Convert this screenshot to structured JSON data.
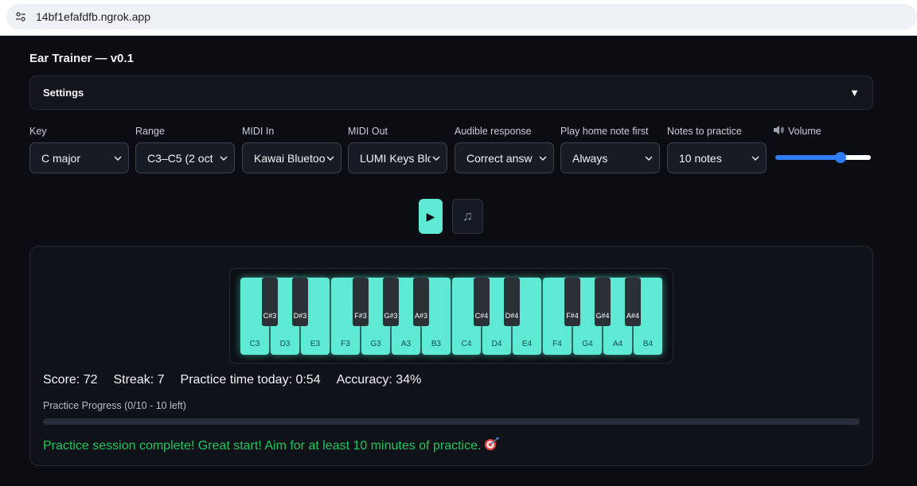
{
  "browser": {
    "url": "14bf1efafdfb.ngrok.app"
  },
  "app": {
    "title": "Ear Trainer — v0.1"
  },
  "settings": {
    "label": "Settings",
    "toggle": "▼"
  },
  "controls": [
    {
      "label": "Key",
      "value": "C major"
    },
    {
      "label": "Range",
      "value": "C3–C5 (2 oct"
    },
    {
      "label": "MIDI In",
      "value": "Kawai Bluetoo"
    },
    {
      "label": "MIDI Out",
      "value": "LUMI Keys Blo"
    },
    {
      "label": "Audible response",
      "value": "Correct answ"
    },
    {
      "label": "Play home note first",
      "value": "Always"
    },
    {
      "label": "Notes to practice",
      "value": "10 notes"
    }
  ],
  "volume": {
    "label": "Volume",
    "icon": "speaker-icon",
    "level": 0.68
  },
  "transport": {
    "play_icon": "▶",
    "note_icon": "♫"
  },
  "keyboard": {
    "white_keys": [
      "C3",
      "D3",
      "E3",
      "F3",
      "G3",
      "A3",
      "B3",
      "C4",
      "D4",
      "E4",
      "F4",
      "G4",
      "A4",
      "B4"
    ],
    "black_keys": [
      "C#3",
      "D#3",
      "F#3",
      "G#3",
      "A#3",
      "C#4",
      "D#4",
      "F#4",
      "G#4",
      "A#4"
    ]
  },
  "stats": {
    "score": "Score: 72",
    "streak": "Streak: 7",
    "practice_time": "Practice time today: 0:54",
    "accuracy": "Accuracy: 34%"
  },
  "progress": {
    "label": "Practice Progress (0/10 - 10 left)",
    "fraction": 0
  },
  "message": {
    "text": "Practice session complete! Great start! Aim for at least 10 minutes of practice.",
    "icon": "target-dart-icon"
  },
  "colors": {
    "accent": "#5eead4",
    "success": "#22c55e",
    "slider": "#2f7df6"
  }
}
